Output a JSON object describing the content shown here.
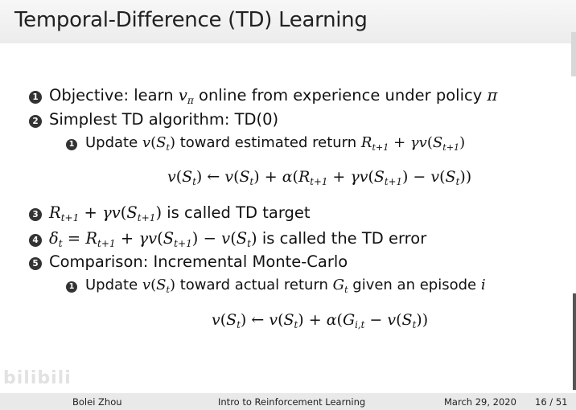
{
  "slide": {
    "title": "Temporal-Difference (TD) Learning",
    "bullets": [
      {
        "num": "1",
        "prefix": "Objective: learn ",
        "v": "v",
        "pi_sub": "π",
        "suffix": " online from experience under policy ",
        "pi": "π"
      },
      {
        "num": "2",
        "text": "Simplest TD algorithm: TD(0)"
      },
      {
        "num": "3",
        "suffix": " is called TD target"
      },
      {
        "num": "4",
        "suffix": " is called the TD error"
      },
      {
        "num": "5",
        "text": "Comparison: Incremental Monte-Carlo"
      }
    ],
    "subbullets": [
      {
        "num": "1",
        "prefix": "Update ",
        "mid": " toward estimated return "
      },
      {
        "num": "1",
        "prefix": "Update ",
        "mid": " toward actual return ",
        "g": "G",
        "g_sub": "t",
        "suffix": " given an episode ",
        "i": "i"
      }
    ],
    "math": {
      "v": "v",
      "S": "S",
      "t": "t",
      "R": "R",
      "t1": "t+1",
      "gamma": "γ",
      "alpha": "α",
      "delta": "δ",
      "G": "G",
      "it": "i,t",
      "lp": "(",
      "rp": ")",
      "plus": " + ",
      "minus": " − ",
      "eq": " = ",
      "arrow": " ← "
    }
  },
  "footer": {
    "author": "Bolei Zhou",
    "course": "Intro to Reinforcement Learning",
    "date": "March 29, 2020",
    "page": "16 / 51"
  },
  "watermark": "bilibili"
}
